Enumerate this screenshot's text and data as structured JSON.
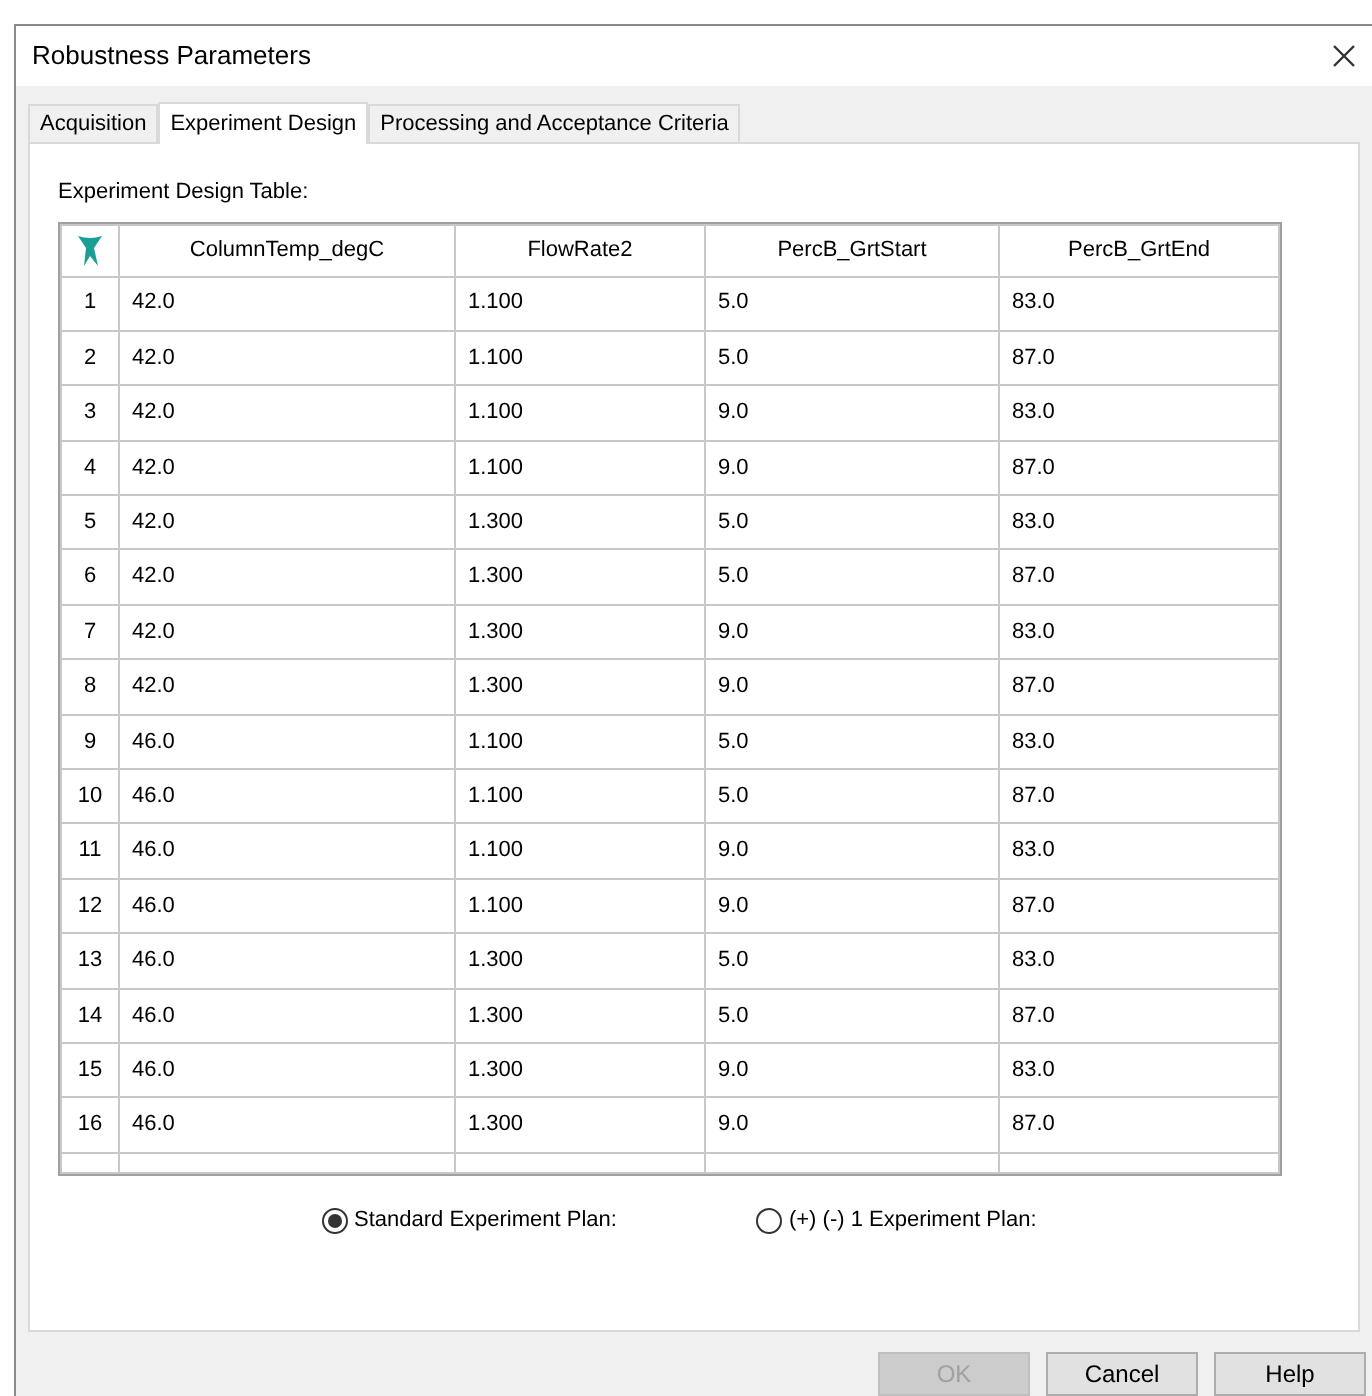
{
  "window": {
    "title": "Robustness Parameters"
  },
  "tabs": [
    {
      "label": "Acquisition",
      "selected": false
    },
    {
      "label": "Experiment Design",
      "selected": true
    },
    {
      "label": "Processing and Acceptance Criteria",
      "selected": false
    }
  ],
  "table": {
    "caption": "Experiment Design Table:",
    "columns": [
      "ColumnTemp_degC",
      "FlowRate2",
      "PercB_GrtStart",
      "PercB_GrtEnd"
    ],
    "rows": [
      {
        "number": "1",
        "cells": [
          "42.0",
          "1.100",
          "5.0",
          "83.0"
        ]
      },
      {
        "number": "2",
        "cells": [
          "42.0",
          "1.100",
          "5.0",
          "87.0"
        ]
      },
      {
        "number": "3",
        "cells": [
          "42.0",
          "1.100",
          "9.0",
          "83.0"
        ]
      },
      {
        "number": "4",
        "cells": [
          "42.0",
          "1.100",
          "9.0",
          "87.0"
        ]
      },
      {
        "number": "5",
        "cells": [
          "42.0",
          "1.300",
          "5.0",
          "83.0"
        ]
      },
      {
        "number": "6",
        "cells": [
          "42.0",
          "1.300",
          "5.0",
          "87.0"
        ]
      },
      {
        "number": "7",
        "cells": [
          "42.0",
          "1.300",
          "9.0",
          "83.0"
        ]
      },
      {
        "number": "8",
        "cells": [
          "42.0",
          "1.300",
          "9.0",
          "87.0"
        ]
      },
      {
        "number": "9",
        "cells": [
          "46.0",
          "1.100",
          "5.0",
          "83.0"
        ]
      },
      {
        "number": "10",
        "cells": [
          "46.0",
          "1.100",
          "5.0",
          "87.0"
        ]
      },
      {
        "number": "11",
        "cells": [
          "46.0",
          "1.100",
          "9.0",
          "83.0"
        ]
      },
      {
        "number": "12",
        "cells": [
          "46.0",
          "1.100",
          "9.0",
          "87.0"
        ]
      },
      {
        "number": "13",
        "cells": [
          "46.0",
          "1.300",
          "5.0",
          "83.0"
        ]
      },
      {
        "number": "14",
        "cells": [
          "46.0",
          "1.300",
          "5.0",
          "87.0"
        ]
      },
      {
        "number": "15",
        "cells": [
          "46.0",
          "1.300",
          "9.0",
          "83.0"
        ]
      },
      {
        "number": "16",
        "cells": [
          "46.0",
          "1.300",
          "9.0",
          "87.0"
        ]
      }
    ]
  },
  "plans": [
    {
      "label": "Standard Experiment Plan:",
      "selected": true
    },
    {
      "label": "(+) (-) 1 Experiment Plan:",
      "selected": false
    }
  ],
  "buttons": [
    {
      "label": "OK",
      "disabled": true
    },
    {
      "label": "Cancel",
      "disabled": false
    },
    {
      "label": "Help",
      "disabled": false
    }
  ]
}
